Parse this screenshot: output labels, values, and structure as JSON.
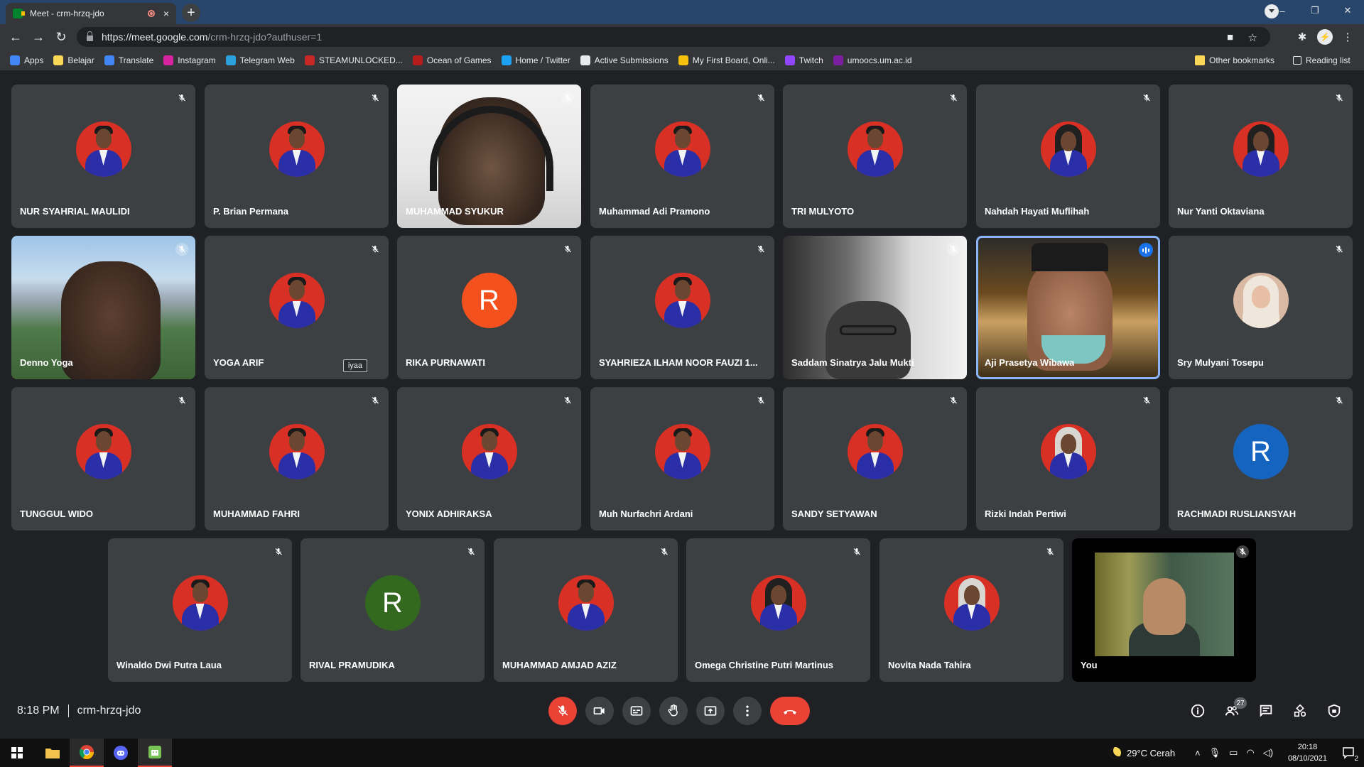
{
  "browser": {
    "tab_title": "Meet - crm-hrzq-jdo",
    "tab_close": "×",
    "new_tab": "+",
    "url_host": "https://meet.google.com",
    "url_path": "/crm-hrzq-jdo?authuser=1",
    "window_controls": [
      "–",
      "❐",
      "✕"
    ]
  },
  "bookmarks": {
    "items": [
      {
        "label": "Apps",
        "color": "#4285f4"
      },
      {
        "label": "Belajar",
        "color": "#f9d857"
      },
      {
        "label": "Translate",
        "color": "#4285f4"
      },
      {
        "label": "Instagram",
        "color": "#d6249f"
      },
      {
        "label": "Telegram Web",
        "color": "#2aa1da"
      },
      {
        "label": "STEAMUNLOCKED...",
        "color": "#c62828"
      },
      {
        "label": "Ocean of Games",
        "color": "#b71c1c"
      },
      {
        "label": "Home / Twitter",
        "color": "#1da1f2"
      },
      {
        "label": "Active Submissions",
        "color": "#e8eaed"
      },
      {
        "label": "My First Board, Onli...",
        "color": "#f4c20d"
      },
      {
        "label": "Twitch",
        "color": "#9146ff"
      },
      {
        "label": "umoocs.um.ac.id",
        "color": "#7b1fa2"
      }
    ],
    "other": "Other bookmarks",
    "reading": "Reading list"
  },
  "participants": [
    {
      "name": "NUR SYAHRIAL MAULIDI",
      "type": "avatar",
      "muted": true
    },
    {
      "name": "P. Brian Permana",
      "type": "avatar",
      "muted": true
    },
    {
      "name": "MUHAMMAD SYUKUR",
      "type": "video",
      "muted": true
    },
    {
      "name": "Muhammad Adi Pramono",
      "type": "avatar",
      "muted": true
    },
    {
      "name": "TRI MULYOTO",
      "type": "avatar",
      "muted": true
    },
    {
      "name": "Nahdah Hayati Muflihah",
      "type": "avatar",
      "muted": true
    },
    {
      "name": "Nur Yanti Oktaviana",
      "type": "avatar",
      "muted": true
    },
    {
      "name": "Denno Yoga",
      "type": "video",
      "muted": true
    },
    {
      "name": "YOGA ARIF",
      "type": "avatar",
      "muted": true,
      "reaction": "iyaa"
    },
    {
      "name": "RIKA PURNAWATI",
      "type": "initial",
      "initial": "R",
      "color": "#f4511e",
      "muted": true
    },
    {
      "name": "SYAHRIEZA ILHAM NOOR FAUZI 1...",
      "type": "avatar",
      "muted": true
    },
    {
      "name": "Saddam Sinatrya Jalu Mukti",
      "type": "video",
      "muted": true
    },
    {
      "name": "Aji Prasetya Wibawa",
      "type": "video",
      "speaking": true
    },
    {
      "name": "Sry Mulyani Tosepu",
      "type": "photo",
      "muted": true
    },
    {
      "name": "TUNGGUL WIDO",
      "type": "avatar",
      "muted": true
    },
    {
      "name": "MUHAMMAD FAHRI",
      "type": "avatar",
      "muted": true
    },
    {
      "name": "YONIX ADHIRAKSA",
      "type": "avatar",
      "muted": true
    },
    {
      "name": "Muh Nurfachri Ardani",
      "type": "avatar",
      "muted": true
    },
    {
      "name": "SANDY SETYAWAN",
      "type": "avatar",
      "muted": true
    },
    {
      "name": "Rizki Indah Pertiwi",
      "type": "avatar",
      "muted": true
    },
    {
      "name": "RACHMADI RUSLIANSYAH",
      "type": "initial",
      "initial": "R",
      "color": "#1565c0",
      "muted": true
    },
    {
      "name": "Winaldo Dwi Putra Laua",
      "type": "avatar",
      "muted": true
    },
    {
      "name": "RIVAL PRAMUDIKA",
      "type": "initial",
      "initial": "R",
      "color": "#33691e",
      "muted": true
    },
    {
      "name": "MUHAMMAD AMJAD AZIZ",
      "type": "avatar",
      "muted": true
    },
    {
      "name": "Omega Christine Putri Martinus",
      "type": "avatar",
      "muted": true
    },
    {
      "name": "Novita Nada Tahira",
      "type": "avatar",
      "muted": true
    },
    {
      "name": "You",
      "type": "video",
      "muted": true
    }
  ],
  "meeting": {
    "time": "8:18 PM",
    "code": "crm-hrzq-jdo",
    "participant_count": "27"
  },
  "taskbar": {
    "weather": "29°C  Cerah",
    "time": "20:18",
    "date": "08/10/2021",
    "notifications": "2"
  }
}
